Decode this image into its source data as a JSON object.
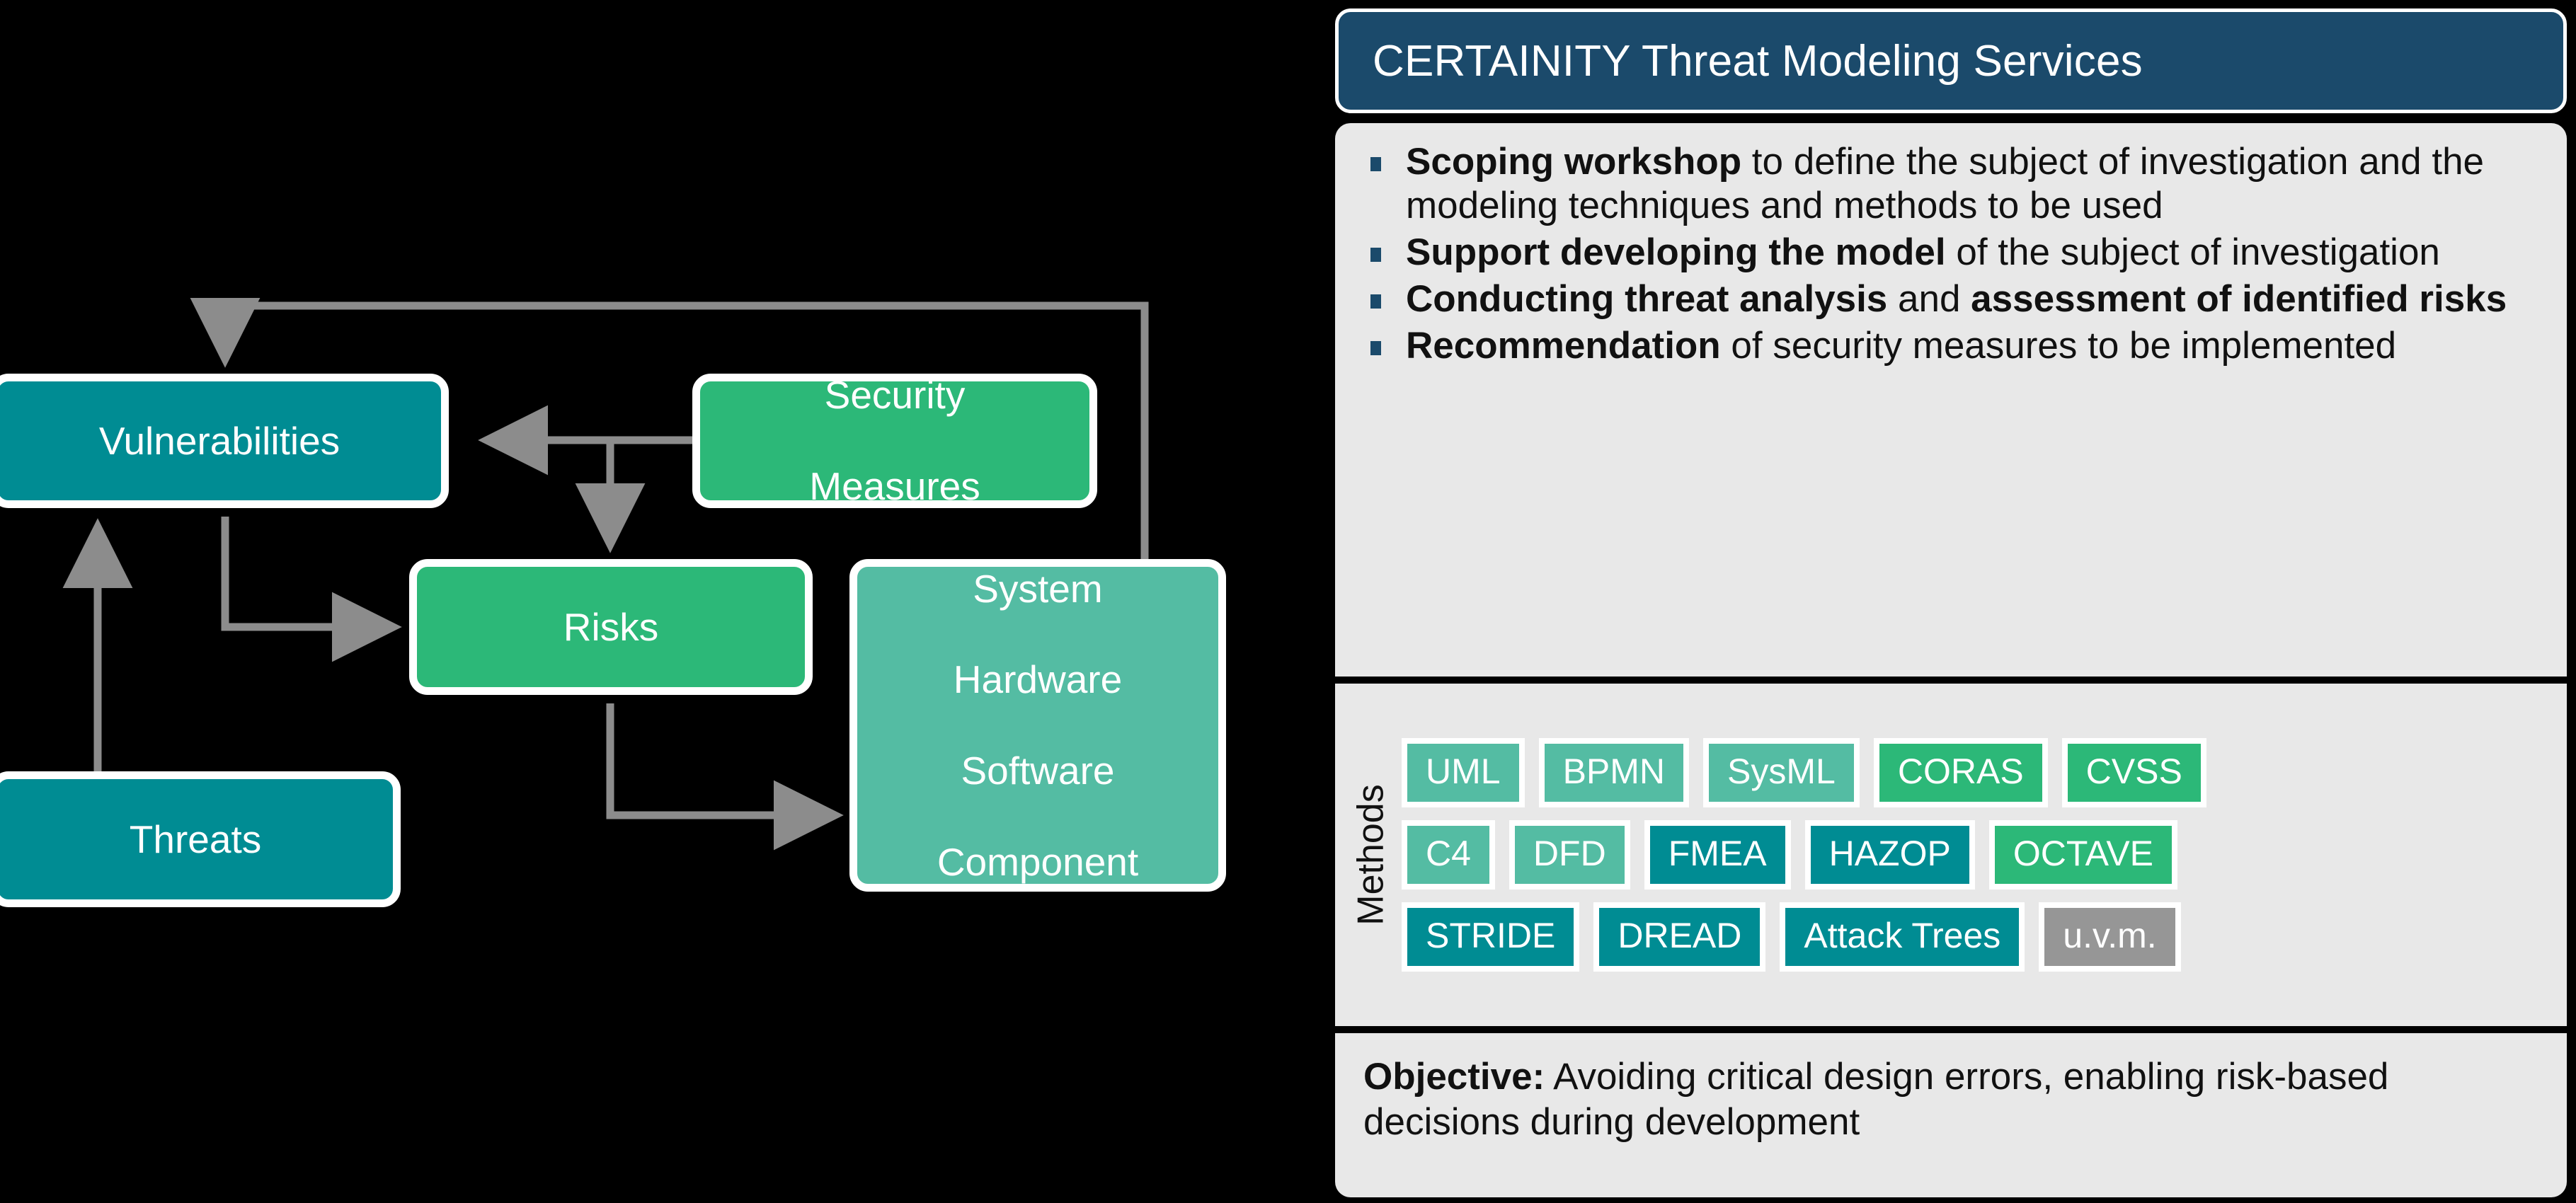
{
  "diagram": {
    "nodes": [
      {
        "id": "vulnerabilities",
        "label": "Vulnerabilities",
        "color": "#008C93"
      },
      {
        "id": "security-measures",
        "label": "Security\nMeasures",
        "line1": "Security",
        "line2": "Measures",
        "color": "#2CB878"
      },
      {
        "id": "risks",
        "label": "Risks",
        "color": "#2CB878"
      },
      {
        "id": "system",
        "line1": "System",
        "line2": "Hardware",
        "line3": "Software",
        "line4": "Component",
        "color": "#54BCA3"
      },
      {
        "id": "threats",
        "label": "Threats",
        "color": "#008C93"
      }
    ],
    "arrow_color": "#8C8C8C",
    "background": "#000000"
  },
  "panel": {
    "header": {
      "title": "CERTAINITY Threat Modeling Services",
      "background": "#1B4A6B",
      "text_color": "#FFFFFF"
    },
    "bullets": [
      {
        "bold": "Scoping workshop",
        "rest": " to define the subject of investigation and the modeling techniques and methods to be used"
      },
      {
        "bold": "Support developing the model",
        "rest": " of the subject of investigation"
      },
      {
        "bold": "Conducting threat analysis",
        "rest": " and ",
        "bold2": "assessment of identified risks"
      },
      {
        "bold": "Recommendation",
        "rest": " of security measures to be implemented"
      }
    ],
    "methods": {
      "label": "Methods",
      "rows": [
        [
          {
            "name": "UML",
            "color": "#54BCA3"
          },
          {
            "name": "BPMN",
            "color": "#54BCA3"
          },
          {
            "name": "SysML",
            "color": "#54BCA3"
          },
          {
            "name": "CORAS",
            "color": "#2CB878"
          },
          {
            "name": "CVSS",
            "color": "#2CB878"
          }
        ],
        [
          {
            "name": "C4",
            "color": "#54BCA3"
          },
          {
            "name": "DFD",
            "color": "#54BCA3"
          },
          {
            "name": "FMEA",
            "color": "#008C93"
          },
          {
            "name": "HAZOP",
            "color": "#008C93"
          },
          {
            "name": "OCTAVE",
            "color": "#2CB878"
          }
        ],
        [
          {
            "name": "STRIDE",
            "color": "#008C93"
          },
          {
            "name": "DREAD",
            "color": "#008C93"
          },
          {
            "name": "Attack Trees",
            "color": "#008C93"
          },
          {
            "name": "u.v.m.",
            "color": "#969696"
          }
        ]
      ]
    },
    "objective": {
      "bold": "Objective:",
      "rest": " Avoiding critical design errors, enabling risk-based decisions during development"
    },
    "background": "#E8E8E8"
  }
}
